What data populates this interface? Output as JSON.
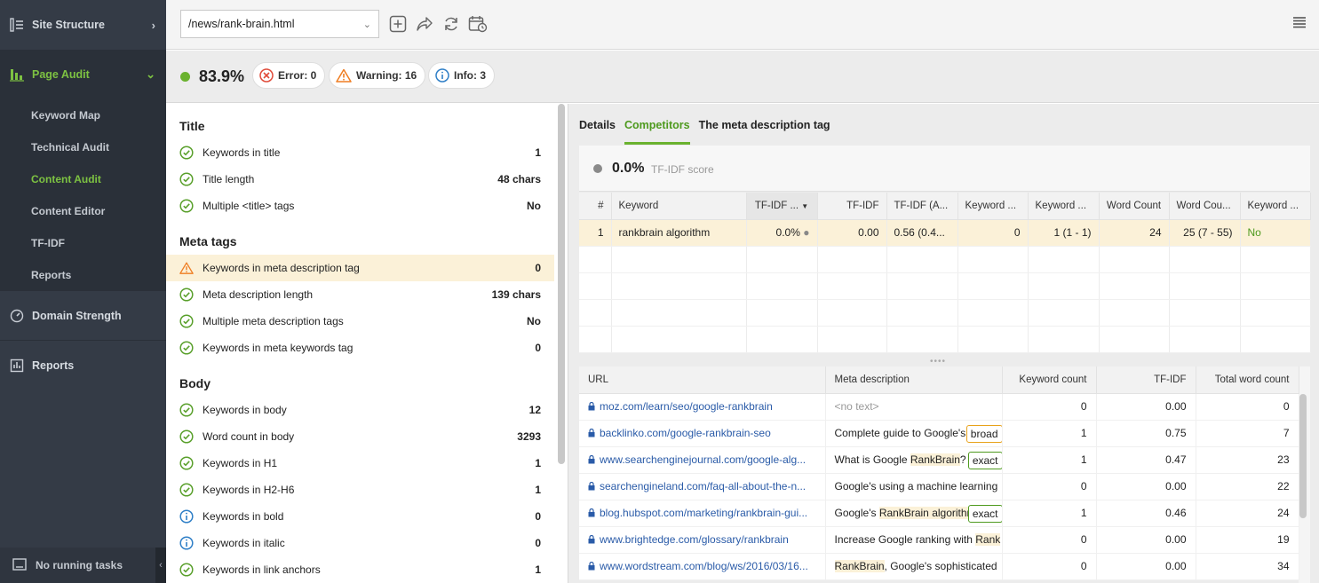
{
  "sidebar": {
    "site_structure": "Site Structure",
    "page_audit": "Page Audit",
    "sub_items": [
      "Keyword Map",
      "Technical Audit",
      "Content Audit",
      "Content Editor",
      "TF-IDF",
      "Reports"
    ],
    "active_sub": "Content Audit",
    "domain_strength": "Domain Strength",
    "reports": "Reports",
    "tasks": "No running tasks"
  },
  "toolbar": {
    "url": "/news/rank-brain.html"
  },
  "score": {
    "value": "83.9%",
    "error": "Error: 0",
    "warning": "Warning: 16",
    "info": "Info: 3"
  },
  "checklist": {
    "title": {
      "heading": "Title",
      "rows": [
        {
          "label": "Keywords in title",
          "value": "1",
          "status": "ok"
        },
        {
          "label": "Title length",
          "value": "48 chars",
          "status": "ok"
        },
        {
          "label": "Multiple <title> tags",
          "value": "No",
          "status": "ok"
        }
      ]
    },
    "meta": {
      "heading": "Meta tags",
      "rows": [
        {
          "label": "Keywords in meta description tag",
          "value": "0",
          "status": "warning"
        },
        {
          "label": "Meta description length",
          "value": "139 chars",
          "status": "ok"
        },
        {
          "label": "Multiple meta description tags",
          "value": "No",
          "status": "ok"
        },
        {
          "label": "Keywords in meta keywords tag",
          "value": "0",
          "status": "ok"
        }
      ]
    },
    "body": {
      "heading": "Body",
      "rows": [
        {
          "label": "Keywords in body",
          "value": "12",
          "status": "ok"
        },
        {
          "label": "Word count in body",
          "value": "3293",
          "status": "ok"
        },
        {
          "label": "Keywords in H1",
          "value": "1",
          "status": "ok"
        },
        {
          "label": "Keywords in H2-H6",
          "value": "1",
          "status": "ok"
        },
        {
          "label": "Keywords in bold",
          "value": "0",
          "status": "info"
        },
        {
          "label": "Keywords in italic",
          "value": "0",
          "status": "info"
        },
        {
          "label": "Keywords in link anchors",
          "value": "1",
          "status": "ok"
        }
      ]
    }
  },
  "tabs": [
    "Details",
    "Competitors",
    "The meta description tag"
  ],
  "active_tab": "Competitors",
  "tfidf": {
    "score": "0.0%",
    "caption": "TF-IDF score"
  },
  "keyword_table": {
    "headers": [
      "#",
      "Keyword",
      "TF-IDF ...",
      "TF-IDF",
      "TF-IDF (A...",
      "Keyword ...",
      "Keyword ...",
      "Word Count",
      "Word Cou...",
      "Keyword ..."
    ],
    "rows": [
      [
        "1",
        "rankbrain algorithm",
        "0.0%",
        "0.00",
        "0.56 (0.4...",
        "0",
        "1 (1 - 1)",
        "24",
        "25 (7 - 55)",
        "No"
      ]
    ]
  },
  "url_table": {
    "headers": [
      "URL",
      "Meta description",
      "Keyword count",
      "TF-IDF",
      "Total word count"
    ],
    "rows": [
      {
        "url": "moz.com/learn/seo/google-rankbrain",
        "meta_pre": "<no text>",
        "meta_mark": "",
        "meta_post": "",
        "tag": "",
        "kc": "0",
        "tfidf": "0.00",
        "twc": "0",
        "dim": true
      },
      {
        "url": "backlinko.com/google-rankbrain-seo",
        "meta_pre": "Complete guide to Google's AI ",
        "meta_mark": "algo",
        "meta_post": "",
        "tag": "broad",
        "kc": "1",
        "tfidf": "0.75",
        "twc": "7",
        "dim": false
      },
      {
        "url": "www.searchenginejournal.com/google-alg...",
        "meta_pre": "What is Google ",
        "meta_mark": "RankBrain",
        "meta_post": "? How do",
        "tag": "exact",
        "kc": "1",
        "tfidf": "0.47",
        "twc": "23",
        "dim": false
      },
      {
        "url": "searchengineland.com/faq-all-about-the-n...",
        "meta_pre": "Google's using a machine learning",
        "meta_mark": "",
        "meta_post": "",
        "tag": "",
        "kc": "0",
        "tfidf": "0.00",
        "twc": "22",
        "dim": false
      },
      {
        "url": "blog.hubspot.com/marketing/rankbrain-gui...",
        "meta_pre": "Google's ",
        "meta_mark": "RankBrain algorithm",
        "meta_post": " cha",
        "tag": "exact",
        "kc": "1",
        "tfidf": "0.46",
        "twc": "24",
        "dim": false
      },
      {
        "url": "www.brightedge.com/glossary/rankbrain",
        "meta_pre": "Increase Google ranking with ",
        "meta_mark": "Rank",
        "meta_post": "",
        "tag": "",
        "kc": "0",
        "tfidf": "0.00",
        "twc": "19",
        "dim": false
      },
      {
        "url": "www.wordstream.com/blog/ws/2016/03/16...",
        "meta_pre": "",
        "meta_mark": "RankBrain",
        "meta_post": ", Google's sophisticated",
        "tag": "",
        "kc": "0",
        "tfidf": "0.00",
        "twc": "34",
        "dim": false
      }
    ]
  },
  "colors": {
    "accent_green": "#6ab22e",
    "warning_orange": "#ef7d22",
    "error_red": "#e04b3a",
    "info_blue": "#2f7fc7",
    "sidebar_bg": "#343b46"
  }
}
